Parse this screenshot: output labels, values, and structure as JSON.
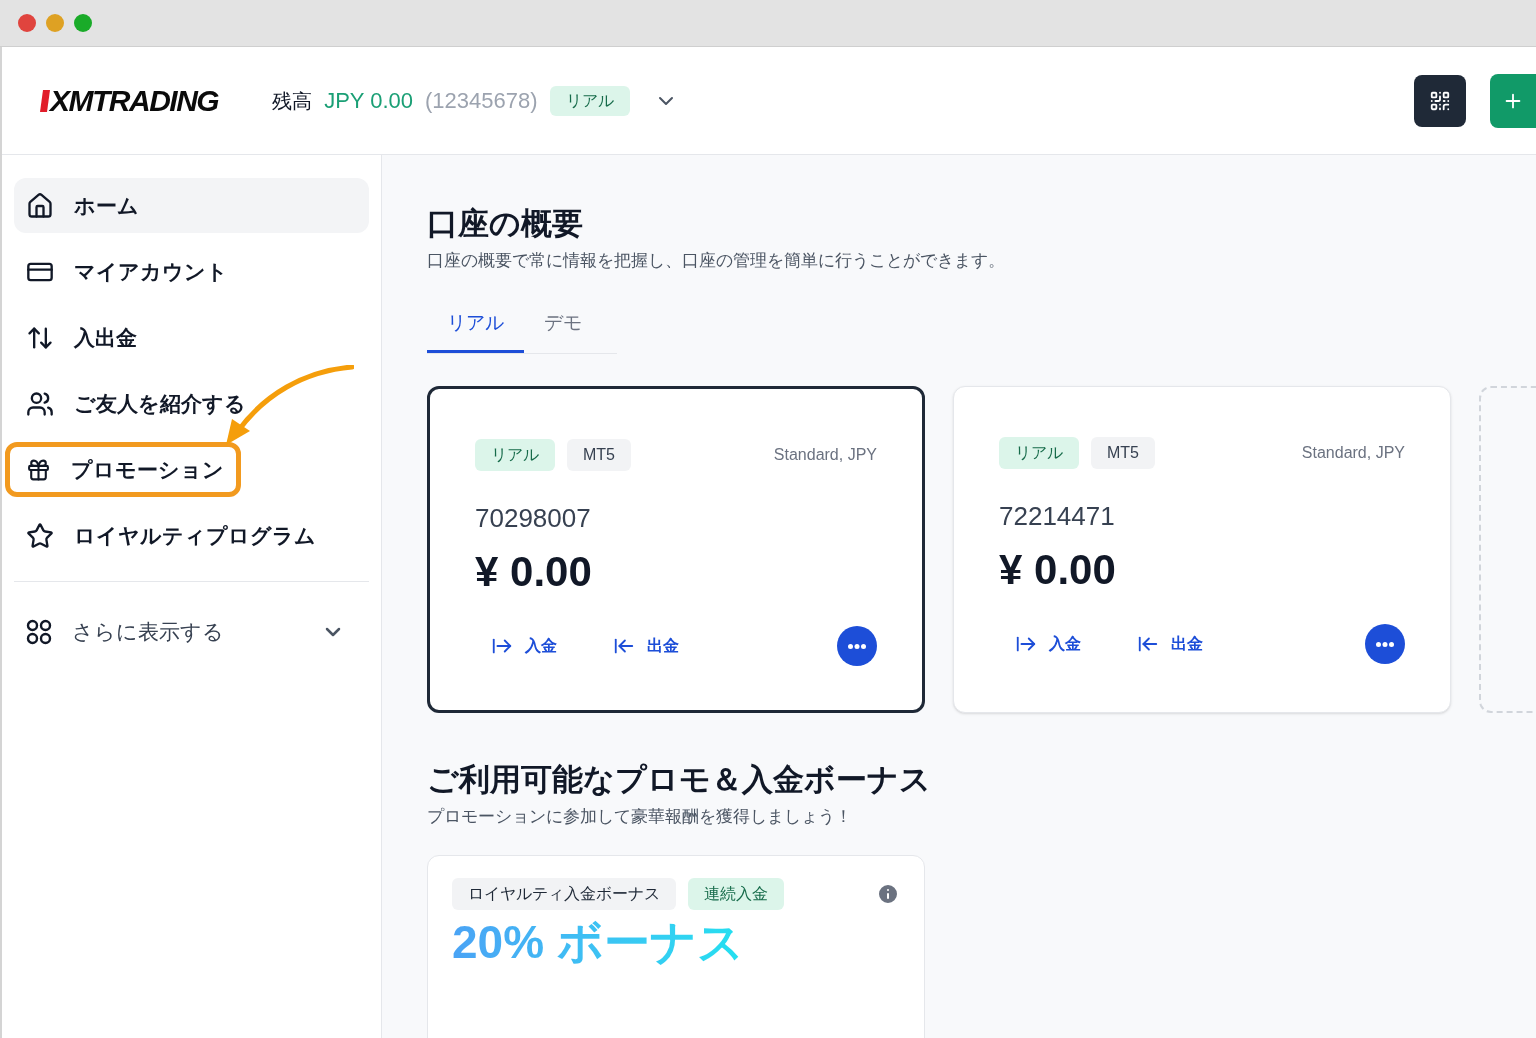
{
  "header": {
    "logo": "XMTRADING",
    "balance_label": "残高",
    "balance": "JPY 0.00",
    "account": "(12345678)",
    "badge": "リアル"
  },
  "sidebar": {
    "items": [
      {
        "kind": "home",
        "label": "ホーム",
        "selected": true,
        "highlighted": false
      },
      {
        "kind": "account",
        "label": "マイアカウント",
        "selected": false,
        "highlighted": false
      },
      {
        "kind": "transfer",
        "label": "入出金",
        "selected": false,
        "highlighted": false
      },
      {
        "kind": "friends",
        "label": "ご友人を紹介する",
        "selected": false,
        "highlighted": false
      },
      {
        "kind": "gift",
        "label": "プロモーション",
        "selected": false,
        "highlighted": true
      },
      {
        "kind": "star",
        "label": "ロイヤルティプログラム",
        "selected": false,
        "highlighted": false
      }
    ],
    "more": {
      "label": "さらに表示する",
      "expanded": false
    }
  },
  "overview": {
    "title": "口座の概要",
    "subtitle": "口座の概要で常に情報を把握し、口座の管理を簡単に行うことができます。",
    "tabs": [
      {
        "label": "リアル",
        "selected": true
      },
      {
        "label": "デモ",
        "selected": false
      }
    ],
    "accounts": [
      {
        "type": "リアル",
        "platform": "MT5",
        "plan": "Standard, JPY",
        "number": "70298007",
        "balance": "¥ 0.00",
        "deposit": "入金",
        "withdraw": "出金",
        "selected": true
      },
      {
        "type": "リアル",
        "platform": "MT5",
        "plan": "Standard, JPY",
        "number": "72214471",
        "balance": "¥ 0.00",
        "deposit": "入金",
        "withdraw": "出金",
        "selected": false
      }
    ]
  },
  "promotions": {
    "title": "ご利用可能なプロモ＆入金ボーナス",
    "subtitle": "プロモーションに参加して豪華報酬を獲得しましょう！",
    "card": {
      "tags": [
        {
          "label": "ロイヤルティ入金ボーナス",
          "kind": "neutral"
        },
        {
          "label": "連続入金",
          "kind": "green"
        }
      ],
      "headline": "20% ボーナス"
    }
  }
}
